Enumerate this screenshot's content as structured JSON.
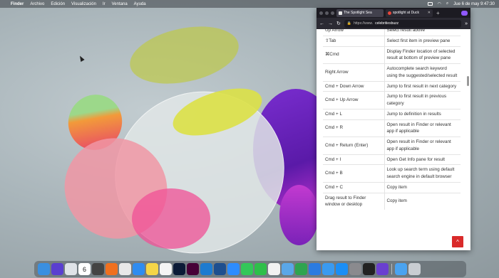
{
  "menubar": {
    "apple": "",
    "app_name": "Finder",
    "menus": [
      "Archivo",
      "Edición",
      "Visualización",
      "Ir",
      "Ventana",
      "Ayuda"
    ],
    "clock": "Jue 6 de may  9:47:30"
  },
  "browser": {
    "tabs": [
      {
        "label": "The Spotlight Sea"
      },
      {
        "label": "spotlight at Duck"
      }
    ],
    "url_prefix": "https://www.",
    "url_host": "celebritiesbuzz",
    "shortcuts": [
      {
        "key": "Up Arrow",
        "desc": "Select result above"
      },
      {
        "key": "⇧Tab",
        "desc": "Select first item in preview pane"
      },
      {
        "key": "⌘Cmd",
        "desc": "Display Finder location of selected result at bottom of preview pane"
      },
      {
        "key": "Right Arrow",
        "desc": "Autocomplete search keyword using the suggested/selected result"
      },
      {
        "key": "Cmd + Down Arrow",
        "desc": "Jump to first result in next category"
      },
      {
        "key": "Cmd + Up Arrow",
        "desc": "Jump to first result in previous category"
      },
      {
        "key": "Cmd + L",
        "desc": "Jump to definition in results"
      },
      {
        "key": "Cmd + R",
        "desc": "Open result in Finder or relevant app if applicable"
      },
      {
        "key": "Cmd + Return (Enter)",
        "desc": "Open result in Finder or relevant app if applicable"
      },
      {
        "key": "Cmd + I",
        "desc": "Open Get Info pane for result"
      },
      {
        "key": "Cmd + B",
        "desc": "Look up search term using default search engine in default browser"
      },
      {
        "key": "Cmd + C",
        "desc": "Copy item"
      },
      {
        "key": "Drag result to Finder window or desktop",
        "desc": "Copy item"
      }
    ],
    "back_to_top_icon": "arrow-up-icon"
  },
  "dock": {
    "calendar_day": "6",
    "icons": [
      "finder",
      "siri",
      "launchpad",
      "calendar",
      "calculator",
      "firefox",
      "chrome",
      "safari",
      "notes",
      "reminders",
      "photoshop",
      "xd",
      "vscode",
      "virtualbox",
      "zoom",
      "messages",
      "facetime",
      "photos",
      "preview",
      "numbers",
      "keynote",
      "mail",
      "app-store",
      "system-preferences",
      "terminal",
      "imovie",
      "downloads",
      "trash"
    ]
  },
  "colors": {
    "accent": "#d92a2a",
    "firefox_dark": "#1c1b22"
  }
}
